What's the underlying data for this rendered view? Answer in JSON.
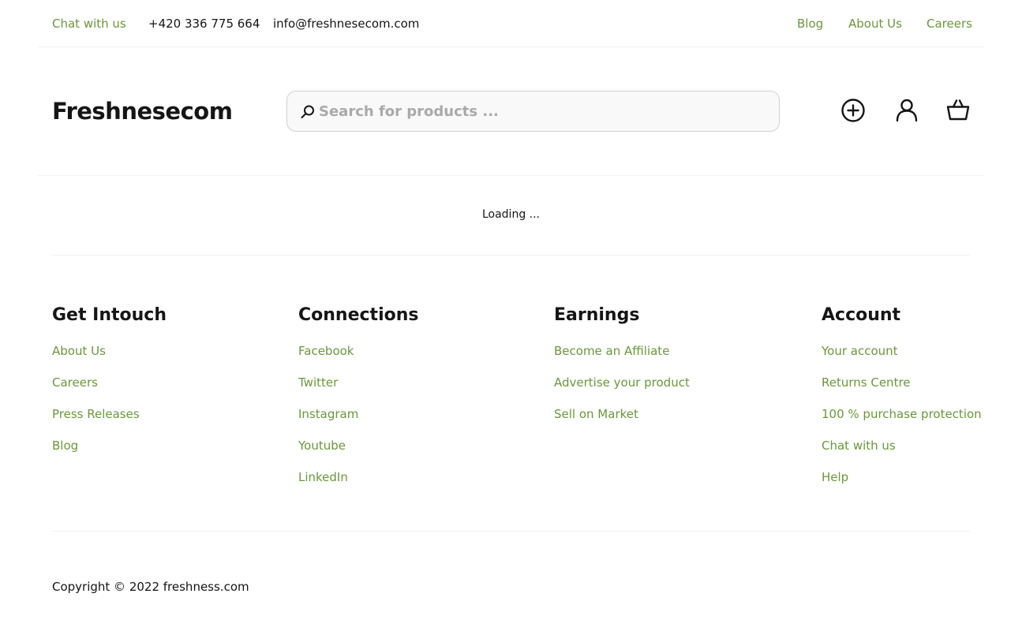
{
  "topbar": {
    "chat": "Chat with us",
    "phone": "+420 336 775 664",
    "email": "info@freshnesecom.com",
    "links": [
      "Blog",
      "About Us",
      "Careers"
    ]
  },
  "header": {
    "logo": "Freshnesecom",
    "search_placeholder": "Search for products ...",
    "icons": [
      "add-circle-icon",
      "user-icon",
      "basket-icon"
    ]
  },
  "main": {
    "status": "Loading ..."
  },
  "footer": {
    "columns": [
      {
        "title": "Get Intouch",
        "links": [
          "About Us",
          "Careers",
          "Press Releases",
          "Blog"
        ]
      },
      {
        "title": "Connections",
        "links": [
          "Facebook",
          "Twitter",
          "Instagram",
          "Youtube",
          "LinkedIn"
        ]
      },
      {
        "title": "Earnings",
        "links": [
          "Become an Affiliate",
          "Advertise your product",
          "Sell on Market"
        ]
      },
      {
        "title": "Account",
        "links": [
          "Your account",
          "Returns Centre",
          "100 % purchase protection",
          "Chat with us",
          "Help"
        ]
      }
    ],
    "copyright": "Copyright © 2022 freshness.com"
  },
  "colors": {
    "accent": "#6a983c",
    "text": "#151515",
    "divider": "#f1f1f1"
  }
}
